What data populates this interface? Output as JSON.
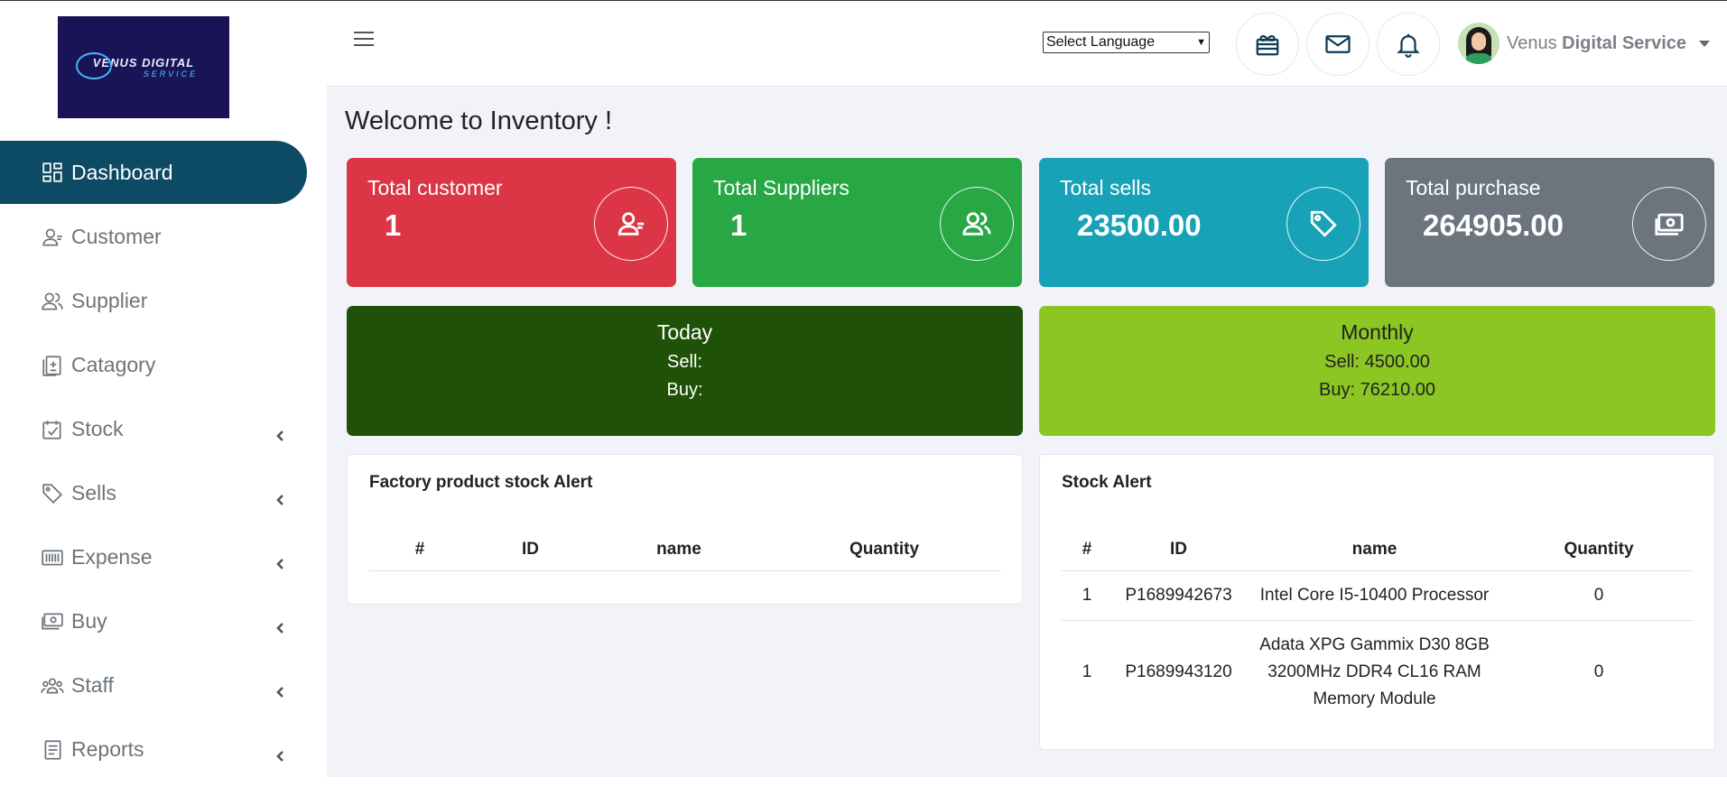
{
  "brand": {
    "logo_main": "VENUS DIGITAL",
    "logo_sub": "SERVICE"
  },
  "sidebar": {
    "items": [
      {
        "label": "Dashboard",
        "icon": "dashboard-icon",
        "active": true,
        "has_chevron": false
      },
      {
        "label": "Customer",
        "icon": "user-icon",
        "active": false,
        "has_chevron": false
      },
      {
        "label": "Supplier",
        "icon": "users-icon",
        "active": false,
        "has_chevron": false
      },
      {
        "label": "Catagory",
        "icon": "clipboard-icon",
        "active": false,
        "has_chevron": false
      },
      {
        "label": "Stock",
        "icon": "calendar-check-icon",
        "active": false,
        "has_chevron": true
      },
      {
        "label": "Sells",
        "icon": "tag-icon",
        "active": false,
        "has_chevron": true
      },
      {
        "label": "Expense",
        "icon": "barcode-icon",
        "active": false,
        "has_chevron": true
      },
      {
        "label": "Buy",
        "icon": "money-icon",
        "active": false,
        "has_chevron": true
      },
      {
        "label": "Staff",
        "icon": "team-icon",
        "active": false,
        "has_chevron": true
      },
      {
        "label": "Reports",
        "icon": "report-icon",
        "active": false,
        "has_chevron": true
      }
    ]
  },
  "header": {
    "language_select": {
      "selected": "Select Language"
    },
    "icons": [
      "gift-card-icon",
      "mail-icon",
      "bell-icon"
    ],
    "user": {
      "name_part1": "Venus",
      "name_part2": "Digital Service"
    }
  },
  "main": {
    "title": "Welcome to Inventory !",
    "stats": [
      {
        "label": "Total customer",
        "value": "1",
        "color": "#dc3545",
        "icon": "user-icon"
      },
      {
        "label": "Total Suppliers",
        "value": "1",
        "color": "#28a745",
        "icon": "users-icon"
      },
      {
        "label": "Total sells",
        "value": "23500.00",
        "color": "#17a2b8",
        "icon": "tag-icon"
      },
      {
        "label": "Total purchase",
        "value": "264905.00",
        "color": "#6c757d",
        "icon": "money-icon"
      }
    ],
    "today": {
      "title": "Today",
      "sell": "Sell:",
      "buy": "Buy:",
      "color": "#1f5208"
    },
    "monthly": {
      "title": "Monthly",
      "sell": "Sell: 4500.00",
      "buy": "Buy: 76210.00",
      "color": "#8bc622"
    },
    "factory_alert": {
      "title": "Factory product stock Alert",
      "columns": [
        "#",
        "ID",
        "name",
        "Quantity"
      ],
      "rows": []
    },
    "stock_alert": {
      "title": "Stock Alert",
      "columns": [
        "#",
        "ID",
        "name",
        "Quantity"
      ],
      "rows": [
        {
          "no": "1",
          "id": "P1689942673",
          "name": "Intel Core I5-10400 Processor",
          "qty": "0"
        },
        {
          "no": "1",
          "id": "P1689943120",
          "name": "Adata XPG Gammix D30 8GB 3200MHz DDR4 CL16 RAM Memory Module",
          "qty": "0"
        }
      ]
    }
  }
}
